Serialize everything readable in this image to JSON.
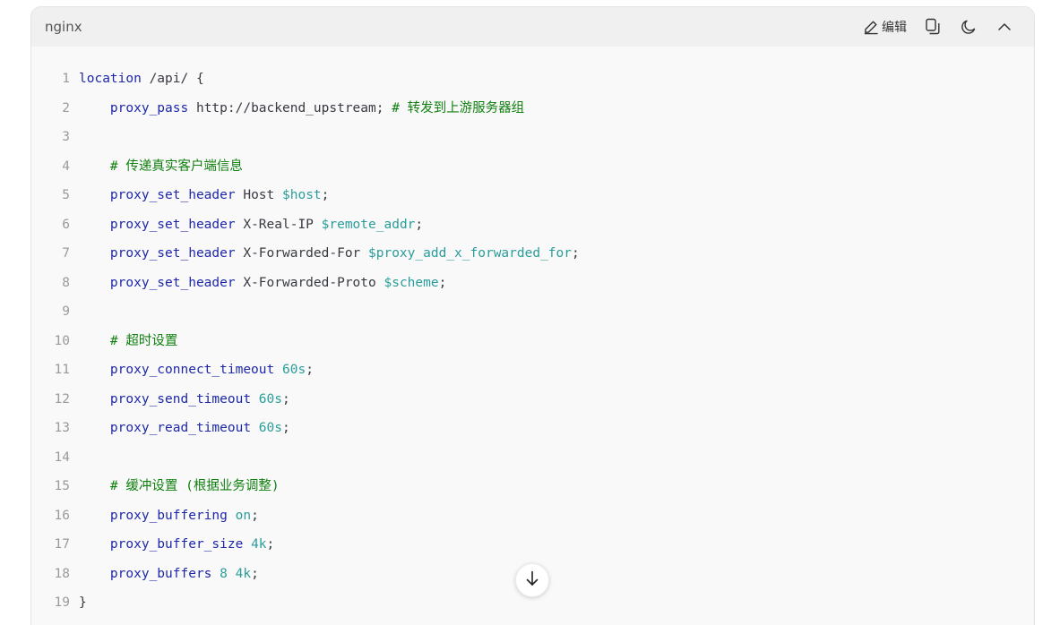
{
  "code_block": {
    "language": "nginx",
    "edit_label": "编辑",
    "lines": [
      [
        {
          "t": "kw",
          "v": "location"
        },
        {
          "t": "tx",
          "v": " /api/ {"
        }
      ],
      [
        {
          "t": "tx",
          "v": "    "
        },
        {
          "t": "kw",
          "v": "proxy_pass"
        },
        {
          "t": "tx",
          "v": " http://backend_upstream; "
        },
        {
          "t": "cm",
          "v": "# 转发到上游服务器组"
        }
      ],
      [],
      [
        {
          "t": "tx",
          "v": "    "
        },
        {
          "t": "cm",
          "v": "# 传递真实客户端信息"
        }
      ],
      [
        {
          "t": "tx",
          "v": "    "
        },
        {
          "t": "kw",
          "v": "proxy_set_header"
        },
        {
          "t": "tx",
          "v": " Host "
        },
        {
          "t": "var",
          "v": "$host"
        },
        {
          "t": "tx",
          "v": ";"
        }
      ],
      [
        {
          "t": "tx",
          "v": "    "
        },
        {
          "t": "kw",
          "v": "proxy_set_header"
        },
        {
          "t": "tx",
          "v": " X-Real-IP "
        },
        {
          "t": "var",
          "v": "$remote_addr"
        },
        {
          "t": "tx",
          "v": ";"
        }
      ],
      [
        {
          "t": "tx",
          "v": "    "
        },
        {
          "t": "kw",
          "v": "proxy_set_header"
        },
        {
          "t": "tx",
          "v": " X-Forwarded-For "
        },
        {
          "t": "var",
          "v": "$proxy_add_x_forwarded_for"
        },
        {
          "t": "tx",
          "v": ";"
        }
      ],
      [
        {
          "t": "tx",
          "v": "    "
        },
        {
          "t": "kw",
          "v": "proxy_set_header"
        },
        {
          "t": "tx",
          "v": " X-Forwarded-Proto "
        },
        {
          "t": "var",
          "v": "$scheme"
        },
        {
          "t": "tx",
          "v": ";"
        }
      ],
      [],
      [
        {
          "t": "tx",
          "v": "    "
        },
        {
          "t": "cm",
          "v": "# 超时设置"
        }
      ],
      [
        {
          "t": "tx",
          "v": "    "
        },
        {
          "t": "kw",
          "v": "proxy_connect_timeout"
        },
        {
          "t": "tx",
          "v": " "
        },
        {
          "t": "num",
          "v": "60s"
        },
        {
          "t": "tx",
          "v": ";"
        }
      ],
      [
        {
          "t": "tx",
          "v": "    "
        },
        {
          "t": "kw",
          "v": "proxy_send_timeout"
        },
        {
          "t": "tx",
          "v": " "
        },
        {
          "t": "num",
          "v": "60s"
        },
        {
          "t": "tx",
          "v": ";"
        }
      ],
      [
        {
          "t": "tx",
          "v": "    "
        },
        {
          "t": "kw",
          "v": "proxy_read_timeout"
        },
        {
          "t": "tx",
          "v": " "
        },
        {
          "t": "num",
          "v": "60s"
        },
        {
          "t": "tx",
          "v": ";"
        }
      ],
      [],
      [
        {
          "t": "tx",
          "v": "    "
        },
        {
          "t": "cm",
          "v": "# 缓冲设置 (根据业务调整)"
        }
      ],
      [
        {
          "t": "tx",
          "v": "    "
        },
        {
          "t": "kw",
          "v": "proxy_buffering"
        },
        {
          "t": "tx",
          "v": " "
        },
        {
          "t": "var",
          "v": "on"
        },
        {
          "t": "tx",
          "v": ";"
        }
      ],
      [
        {
          "t": "tx",
          "v": "    "
        },
        {
          "t": "kw",
          "v": "proxy_buffer_size"
        },
        {
          "t": "tx",
          "v": " "
        },
        {
          "t": "num",
          "v": "4k"
        },
        {
          "t": "tx",
          "v": ";"
        }
      ],
      [
        {
          "t": "tx",
          "v": "    "
        },
        {
          "t": "kw",
          "v": "proxy_buffers"
        },
        {
          "t": "tx",
          "v": " "
        },
        {
          "t": "num",
          "v": "8"
        },
        {
          "t": "tx",
          "v": " "
        },
        {
          "t": "num",
          "v": "4k"
        },
        {
          "t": "tx",
          "v": ";"
        }
      ],
      [
        {
          "t": "tx",
          "v": "}"
        }
      ]
    ]
  },
  "icons": {
    "edit": "pencil-icon",
    "copy": "copy-icon",
    "theme": "moon-icon",
    "collapse": "chevron-up-icon",
    "scroll": "arrow-down-icon"
  },
  "colors": {
    "keyword": "#1e28a8",
    "variable": "#2a9d9a",
    "comment": "#108010",
    "text": "#383a42",
    "line_number": "#9a9a9a",
    "header_bg": "#f0f0f0",
    "body_bg": "#f9f9f9"
  }
}
